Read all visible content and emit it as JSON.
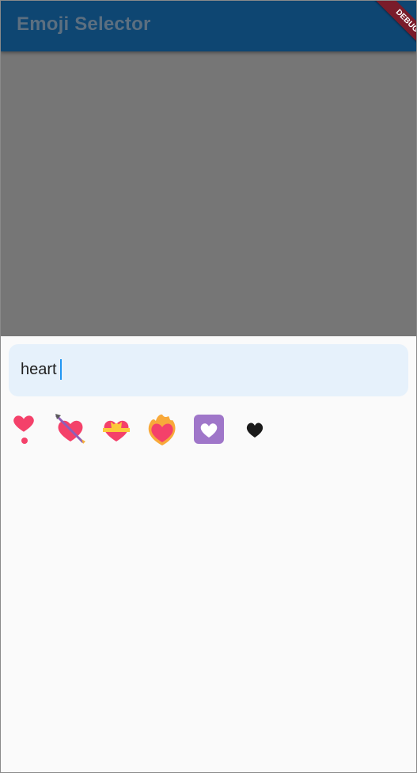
{
  "appbar": {
    "title": "Emoji Selector",
    "debug_label": "DEBUG"
  },
  "search": {
    "value": "heart"
  },
  "results": [
    {
      "name": "heavy-heart-exclamation",
      "color": "#f4416a"
    },
    {
      "name": "heart-with-arrow",
      "color": "#f4416a"
    },
    {
      "name": "heart-with-ribbon",
      "color": "#f4416a"
    },
    {
      "name": "heart-on-fire",
      "color": "#f4416a"
    },
    {
      "name": "heart-decoration",
      "color": "#9f76c9"
    },
    {
      "name": "black-heart",
      "color": "#1a1a1a"
    }
  ],
  "colors": {
    "appbar": "#0e4672",
    "scrim": "#767676",
    "search_bg": "#e6f1fb",
    "caret": "#2196f3",
    "debug": "#7a1c2a"
  }
}
